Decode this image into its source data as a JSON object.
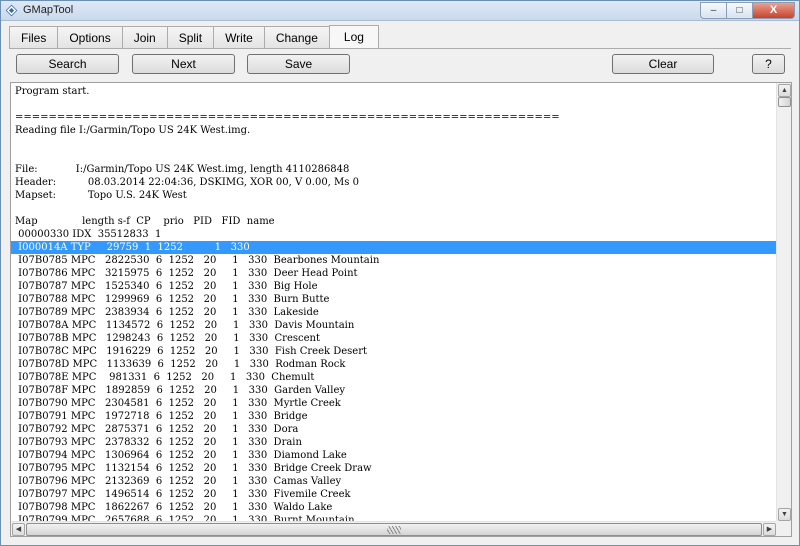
{
  "window": {
    "title": "GMapTool",
    "minimize_glyph": "–",
    "maximize_glyph": "□",
    "close_glyph": "X"
  },
  "tabs": [
    "Files",
    "Options",
    "Join",
    "Split",
    "Write",
    "Change",
    "Log"
  ],
  "active_tab": "Log",
  "toolbar": {
    "search_label": "Search",
    "next_label": "Next",
    "save_label": "Save",
    "clear_label": "Clear",
    "help_label": "?"
  },
  "log": {
    "selected_line": 14,
    "lines": [
      "Program start.",
      "",
      "=================================================================",
      "Reading file I:/Garmin/Topo US 24K West.img.",
      "",
      "",
      "File:            I:/Garmin/Topo US 24K West.img, length 4110286848",
      "Header:          08.03.2014 22:04:36, DSKIMG, XOR 00, V 0.00, Ms 0",
      "Mapset:          Topo U.S. 24K West",
      "",
      "Map              length s-f  CP    prio   PID   FID  name",
      " 00000330 IDX  35512833  1",
      " I000014A TYP     29759  1  1252          1   330",
      " I07B0785 MPC   2822530  6  1252   20     1   330  Bearbones Mountain",
      " I07B0786 MPC   3215975  6  1252   20     1   330  Deer Head Point",
      " I07B0787 MPC   1525340  6  1252   20     1   330  Big Hole",
      " I07B0788 MPC   1299969  6  1252   20     1   330  Burn Butte",
      " I07B0789 MPC   2383934  6  1252   20     1   330  Lakeside",
      " I07B078A MPC   1134572  6  1252   20     1   330  Davis Mountain",
      " I07B078B MPC   1298243  6  1252   20     1   330  Crescent",
      " I07B078C MPC   1916229  6  1252   20     1   330  Fish Creek Desert",
      " I07B078D MPC   1133639  6  1252   20     1   330  Rodman Rock",
      " I07B078E MPC    981331  6  1252   20     1   330  Chemult",
      " I07B078F MPC   1892859  6  1252   20     1   330  Garden Valley",
      " I07B0790 MPC   2304581  6  1252   20     1   330  Myrtle Creek",
      " I07B0791 MPC   1972718  6  1252   20     1   330  Bridge",
      " I07B0792 MPC   2875371  6  1252   20     1   330  Dora",
      " I07B0793 MPC   2378332  6  1252   20     1   330  Drain",
      " I07B0794 MPC   1306964  6  1252   20     1   330  Diamond Lake",
      " I07B0795 MPC   1132154  6  1252   20     1   330  Bridge Creek Draw",
      " I07B0796 MPC   2132369  6  1252   20     1   330  Camas Valley",
      " I07B0797 MPC   1496514  6  1252   20     1   330  Fivemile Creek",
      " I07B0798 MPC   1862267  6  1252   20     1   330  Waldo Lake",
      " I07B0799 MPC   2657688  6  1252   20     1   330  Burnt Mountain"
    ]
  },
  "scrollbars": {
    "up_glyph": "▲",
    "down_glyph": "▼",
    "left_glyph": "◀",
    "right_glyph": "▶"
  }
}
